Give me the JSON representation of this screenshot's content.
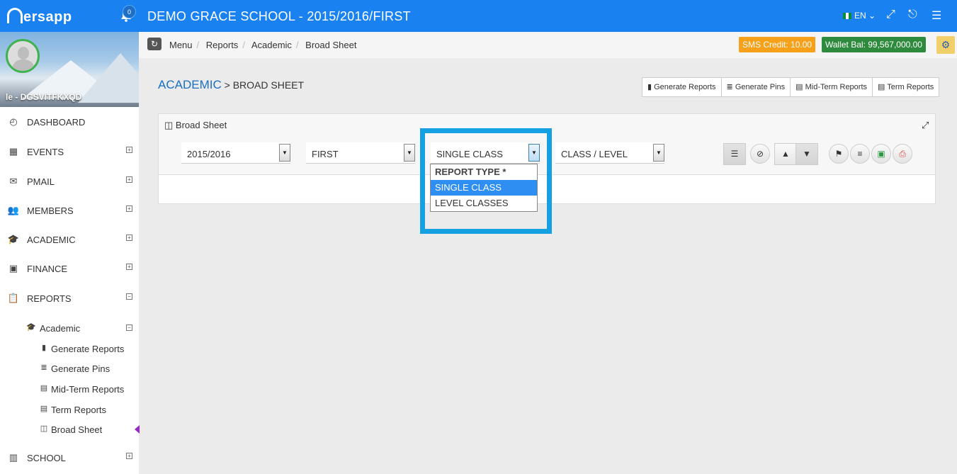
{
  "app": {
    "logo": "nersapp",
    "notification_count": "0",
    "school_title": "DEMO GRACE SCHOOL - 2015/2016/FIRST",
    "language": "EN",
    "accent_color": "#1a82f0"
  },
  "profile": {
    "username": "le - DGSVITFKXQD"
  },
  "sidebar": {
    "items": [
      {
        "label": "DASHBOARD",
        "icon": "dashboard-icon"
      },
      {
        "label": "EVENTS",
        "icon": "calendar-icon",
        "toggle": "+"
      },
      {
        "label": "PMAIL",
        "icon": "envelope-icon",
        "toggle": "+"
      },
      {
        "label": "MEMBERS",
        "icon": "users-icon",
        "toggle": "+"
      },
      {
        "label": "ACADEMIC",
        "icon": "graduation-cap-icon",
        "toggle": "+"
      },
      {
        "label": "FINANCE",
        "icon": "money-icon",
        "toggle": "+"
      },
      {
        "label": "REPORTS",
        "icon": "clipboard-icon",
        "toggle": "−"
      },
      {
        "label": "SCHOOL",
        "icon": "building-icon",
        "toggle": "+"
      }
    ],
    "reports_sub": {
      "label": "Academic",
      "toggle": "−",
      "children": [
        "Generate Reports",
        "Generate Pins",
        "Mid-Term Reports",
        "Term Reports",
        "Broad Sheet"
      ]
    }
  },
  "breadcrumb": [
    "Menu",
    "Reports",
    "Academic",
    "Broad Sheet"
  ],
  "header_badges": {
    "sms_credit": "SMS Credit: 10.00",
    "wallet_balance": "Wallet Bal: 99,567,000.00"
  },
  "page": {
    "heading_main": "ACADEMIC",
    "heading_rest": " > BROAD SHEET",
    "buttons": [
      "Generate Reports",
      "Generate Pins",
      "Mid-Term Reports",
      "Term Reports"
    ]
  },
  "panel": {
    "title": "Broad Sheet",
    "session": "2015/2016",
    "term": "FIRST",
    "report_type": "SINGLE CLASS",
    "class_level": "CLASS / LEVEL"
  },
  "dropdown": {
    "header": "REPORT TYPE *",
    "options": [
      "SINGLE CLASS",
      "LEVEL CLASSES"
    ],
    "selected": "SINGLE CLASS"
  }
}
